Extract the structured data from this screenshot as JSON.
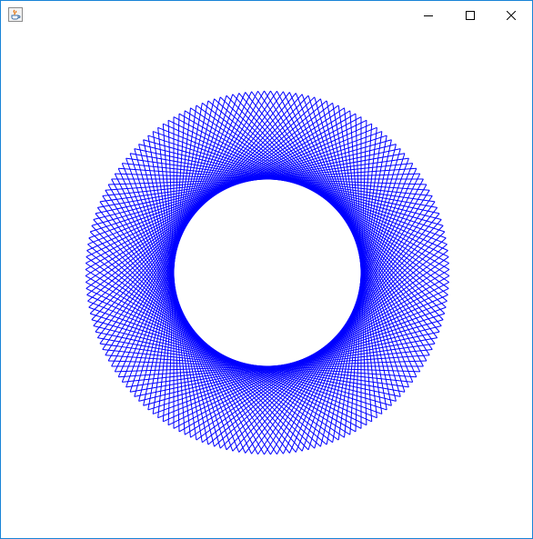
{
  "window": {
    "title": "",
    "icon": "java-cup-icon",
    "controls": {
      "minimize_icon": "minimize-icon",
      "maximize_icon": "maximize-icon",
      "close_icon": "close-icon"
    },
    "border_color": "#1883d7"
  },
  "drawing": {
    "description_type": "string-art-circle",
    "stroke_color": "#0000ff",
    "line_count": 180,
    "step_multiplier": 0.5
  }
}
